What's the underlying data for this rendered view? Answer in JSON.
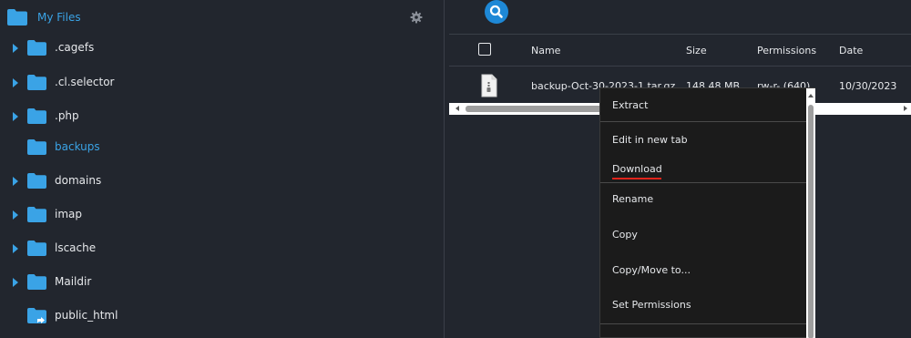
{
  "sidebar": {
    "root_label": "My Files",
    "settings_icon": "gear-icon",
    "folder_color": "#3aa3e6",
    "items": [
      {
        "label": ".cagefs",
        "has_children": true
      },
      {
        "label": ".cl.selector",
        "has_children": true
      },
      {
        "label": ".php",
        "has_children": true
      },
      {
        "label": "backups",
        "has_children": false,
        "active": true
      },
      {
        "label": "domains",
        "has_children": true
      },
      {
        "label": "imap",
        "has_children": true
      },
      {
        "label": "lscache",
        "has_children": true
      },
      {
        "label": "Maildir",
        "has_children": true
      },
      {
        "label": "public_html",
        "has_children": false,
        "linked": true
      }
    ]
  },
  "toolbar": {
    "search_icon": "search-icon",
    "accent": "#1e88d6"
  },
  "table": {
    "columns": [
      "Name",
      "Size",
      "Permissions",
      "Date"
    ],
    "rows": [
      {
        "name": "backup-Oct-30-2023-1.tar.gz",
        "size": "148.48 MB",
        "permissions": "rw-r- (640)",
        "date": "10/30/2023",
        "icon": "archive-file-icon"
      }
    ]
  },
  "context_menu": {
    "items": [
      {
        "label": "Extract"
      },
      {
        "label": "Edit in new tab"
      },
      {
        "label": "Download",
        "highlighted": true
      },
      {
        "label": "Rename"
      },
      {
        "label": "Copy"
      },
      {
        "label": "Copy/Move to..."
      },
      {
        "label": "Set Permissions"
      }
    ],
    "highlight_color": "#e0241b"
  }
}
